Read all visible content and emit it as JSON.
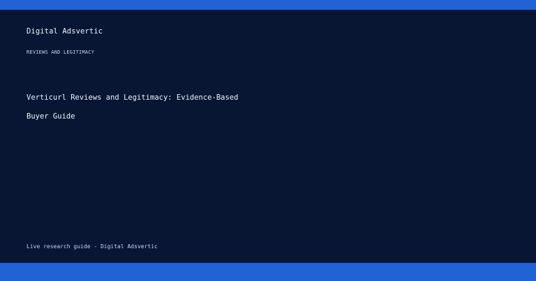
{
  "theme": {
    "frame_color": "#2163d4",
    "panel_color": "#081634",
    "text_color": "#f0f4fa"
  },
  "card": {
    "brand": "Digital Adsvertic",
    "eyebrow": "REVIEWS AND LEGITIMACY",
    "headline_line1": "Verticurl Reviews and Legitimacy: Evidence-Based",
    "headline_line2": "Buyer Guide",
    "footer": "Live research guide - Digital Adsvertic"
  }
}
